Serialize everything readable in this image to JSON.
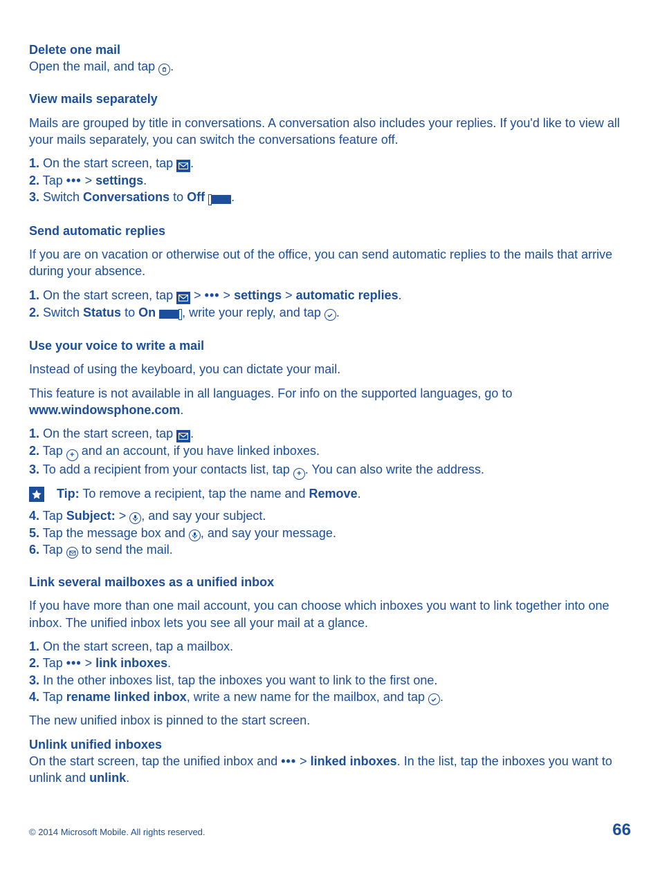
{
  "s1": {
    "title": "Delete one mail",
    "line_a": "Open the mail, and tap ",
    "line_b": "."
  },
  "s2": {
    "title": "View mails separately",
    "intro": "Mails are grouped by title in conversations. A conversation also includes your replies. If you'd like to view all your mails separately, you can switch the conversations feature off.",
    "n1": "1.",
    "l1a": " On the start screen, tap ",
    "l1b": ".",
    "n2": "2.",
    "l2a": " Tap ",
    "l2b": " > ",
    "l2c": "settings",
    "l2d": ".",
    "n3": "3.",
    "l3a": " Switch ",
    "l3b": "Conversations",
    "l3c": " to ",
    "l3d": "Off",
    "l3e": " ",
    "l3f": "."
  },
  "s3": {
    "title": "Send automatic replies",
    "intro": "If you are on vacation or otherwise out of the office, you can send automatic replies to the mails that arrive during your absence.",
    "n1": "1.",
    "l1a": " On the start screen, tap ",
    "l1b": " > ",
    "l1c": " > ",
    "l1d": "settings",
    "l1e": " > ",
    "l1f": "automatic replies",
    "l1g": ".",
    "n2": "2.",
    "l2a": " Switch ",
    "l2b": "Status",
    "l2c": " to ",
    "l2d": "On",
    "l2e": " ",
    "l2f": ", write your reply, and tap ",
    "l2g": "."
  },
  "s4": {
    "title": "Use your voice to write a mail",
    "p1": "Instead of using the keyboard, you can dictate your mail.",
    "p2a": "This feature is not available in all languages. For info on the supported languages, go to ",
    "p2link": "www.windowsphone.com",
    "p2b": ".",
    "n1": "1.",
    "l1a": " On the start screen, tap ",
    "l1b": ".",
    "n2": "2.",
    "l2a": " Tap ",
    "l2b": " and an account, if you have linked inboxes.",
    "n3": "3.",
    "l3a": " To add a recipient from your contacts list, tap ",
    "l3b": ". You can also write the address.",
    "tip_label": "Tip:",
    "tip_text": " To remove a recipient, tap the name and ",
    "tip_bold": "Remove",
    "tip_end": ".",
    "n4": "4.",
    "l4a": " Tap ",
    "l4b": "Subject:",
    "l4c": " > ",
    "l4d": ", and say your subject.",
    "n5": "5.",
    "l5a": " Tap the message box and ",
    "l5b": ", and say your message.",
    "n6": "6.",
    "l6a": " Tap ",
    "l6b": " to send the mail."
  },
  "s5": {
    "title": "Link several mailboxes as a unified inbox",
    "intro": "If you have more than one mail account, you can choose which inboxes you want to link together into one inbox. The unified inbox lets you see all your mail at a glance.",
    "n1": "1.",
    "l1": " On the start screen, tap a mailbox.",
    "n2": "2.",
    "l2a": " Tap ",
    "l2b": " > ",
    "l2c": "link inboxes",
    "l2d": ".",
    "n3": "3.",
    "l3": " In the other inboxes list, tap the inboxes you want to link to the first one.",
    "n4": "4.",
    "l4a": " Tap ",
    "l4b": "rename linked inbox",
    "l4c": ", write a new name for the mailbox, and tap ",
    "l4d": ".",
    "outro": "The new unified inbox is pinned to the start screen."
  },
  "s6": {
    "title": "Unlink unified inboxes",
    "l_a": "On the start screen, tap the unified inbox and ",
    "l_b": " > ",
    "l_c": "linked inboxes",
    "l_d": ". In the list, tap the inboxes you want to unlink and ",
    "l_e": "unlink",
    "l_f": "."
  },
  "footer": {
    "copyright": "© 2014 Microsoft Mobile. All rights reserved.",
    "page": "66"
  }
}
